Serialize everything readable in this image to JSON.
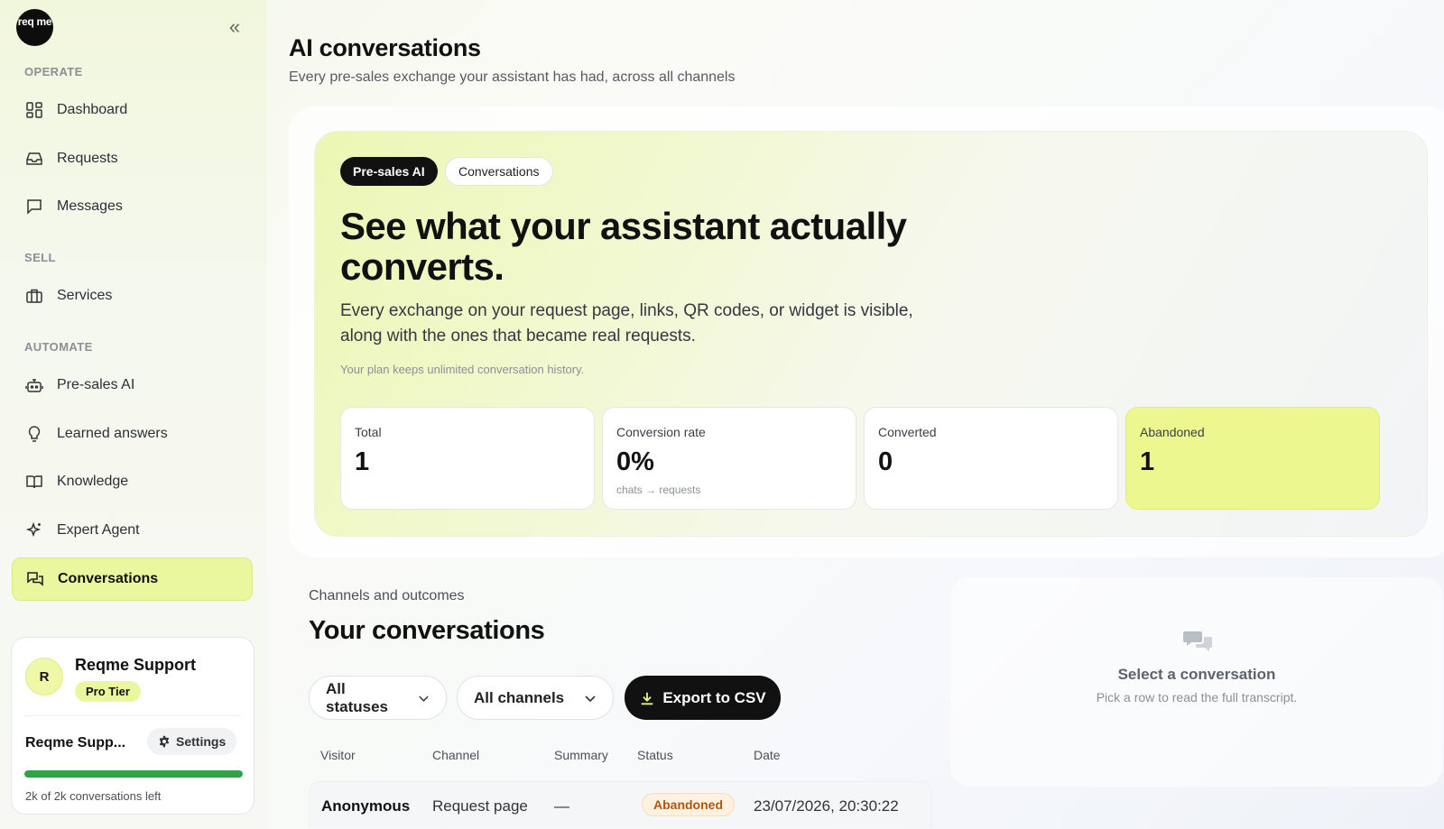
{
  "sidebar": {
    "logo_text": "req me",
    "collapse_icon": "double-chevron-left-icon",
    "sections": {
      "operate": "OPERATE",
      "sell": "SELL",
      "automate": "AUTOMATE"
    },
    "items": [
      {
        "label": "Dashboard",
        "icon": "grid-icon"
      },
      {
        "label": "Requests",
        "icon": "inbox-icon"
      },
      {
        "label": "Messages",
        "icon": "message-square-icon"
      },
      {
        "label": "Services",
        "icon": "briefcase-icon"
      },
      {
        "label": "Pre-sales AI",
        "icon": "bot-icon"
      },
      {
        "label": "Learned answers",
        "icon": "lightbulb-icon"
      },
      {
        "label": "Knowledge",
        "icon": "book-icon"
      },
      {
        "label": "Expert Agent",
        "icon": "sparkle-icon"
      },
      {
        "label": "Conversations",
        "icon": "chats-icon",
        "active": true
      }
    ],
    "user_card": {
      "avatar_initial": "R",
      "name": "Reqme Support",
      "tier": "Pro Tier",
      "org_name": "Reqme Supp...",
      "settings_label": "Settings",
      "quota_text": "2k of 2k conversations left",
      "quota_remaining_fraction": 1.0
    }
  },
  "header": {
    "title": "AI conversations",
    "subtitle": "Every pre-sales exchange your assistant has had, across all channels"
  },
  "hero": {
    "pill_primary": "Pre-sales AI",
    "pill_secondary": "Conversations",
    "title": "See what your assistant actually converts.",
    "text": "Every exchange on your request page, links, QR codes, or widget is visible, along with the ones that became real requests.",
    "note": "Your plan keeps unlimited conversation history.",
    "stats": [
      {
        "label": "Total",
        "value": "1",
        "sub": ""
      },
      {
        "label": "Conversion rate",
        "value": "0%",
        "sub": "chats → requests"
      },
      {
        "label": "Converted",
        "value": "0",
        "sub": ""
      },
      {
        "label": "Abandoned",
        "value": "1",
        "sub": ""
      }
    ]
  },
  "list": {
    "label": "Channels and outcomes",
    "title": "Your conversations",
    "status_filter": "All statuses",
    "channel_filter": "All channels",
    "export_label": "Export to CSV",
    "columns": [
      "Visitor",
      "Channel",
      "Summary",
      "Status",
      "Date"
    ],
    "rows": [
      {
        "visitor": "Anonymous",
        "channel": "Request page",
        "summary": "—",
        "status": "Abandoned",
        "date": "23/07/2026, 20:30:22"
      }
    ]
  },
  "detail": {
    "title": "Select a conversation",
    "subtitle": "Pick a row to read the full transcript."
  },
  "colors": {
    "accent": "#eaf79e",
    "dark": "#111111",
    "progress": "#2fa24a",
    "abandoned_text": "#b0560f"
  }
}
